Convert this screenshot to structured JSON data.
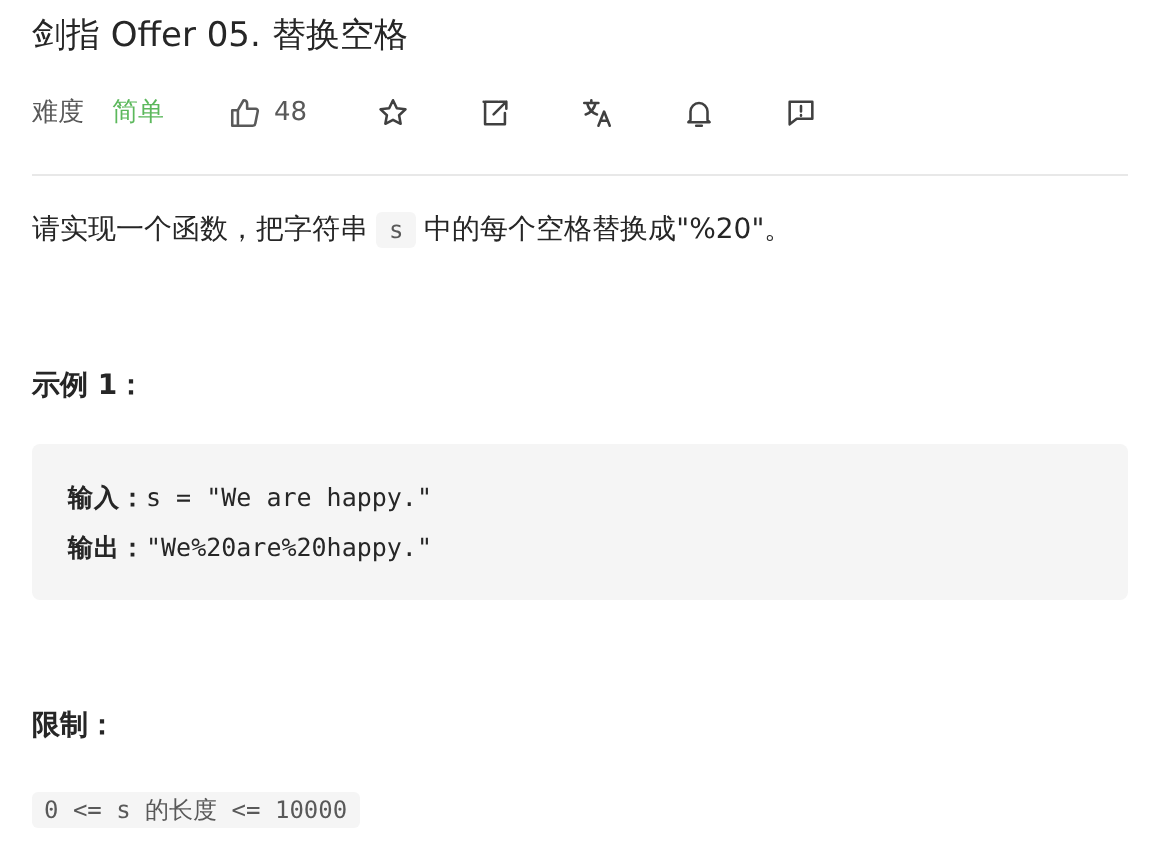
{
  "title": "剑指 Offer 05. 替换空格",
  "meta": {
    "difficulty_label": "难度",
    "difficulty": "简单",
    "likes": "48"
  },
  "actions": [
    {
      "kind": "star"
    },
    {
      "kind": "share"
    },
    {
      "kind": "translate"
    },
    {
      "kind": "bell"
    },
    {
      "kind": "feedback"
    }
  ],
  "description": [
    {
      "kind": "text",
      "text": "请实现一个函数，把字符串 "
    },
    {
      "kind": "code",
      "text": "s"
    },
    {
      "kind": "text",
      "text": " 中的每个空格替换成\"%20\"。"
    }
  ],
  "example": {
    "heading": "示例 1：",
    "lines": [
      {
        "label": "输入：",
        "value": "s = \"We are happy.\""
      },
      {
        "label": "输出：",
        "value": "\"We%20are%20happy.\""
      }
    ]
  },
  "limits": {
    "heading": "限制：",
    "code": "0 <= s 的长度 <= 10000"
  }
}
